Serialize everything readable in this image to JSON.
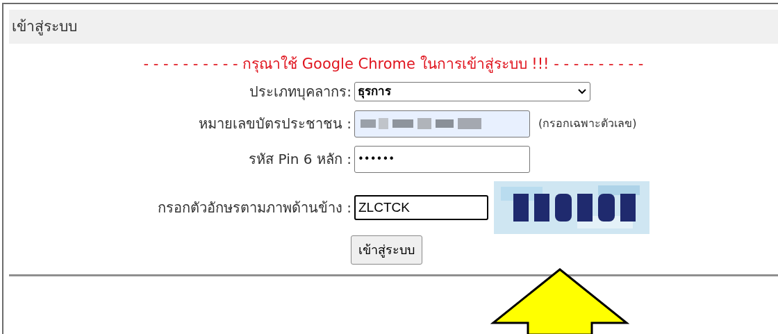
{
  "panel": {
    "title": "เข้าสู่ระบบ"
  },
  "notice": "- - - - - - - - - - กรุณาใช้ Google Chrome ในการเข้าสู่ระบบ !!! - - - -- - - - - -",
  "fields": [
    {
      "kind": "select",
      "label": "ประเภทบุคลากร:",
      "value": "ธุรการ"
    },
    {
      "kind": "redacted",
      "label": "หมายเลขบัตรประชาชน :",
      "hint": "(กรอกเฉพาะตัวเลข)"
    },
    {
      "kind": "password",
      "label": "รหัส Pin 6 หลัก :",
      "value": "••••••"
    },
    {
      "kind": "captcha",
      "label": "กรอกตัวอักษรตามภาพด้านข้าง :",
      "value": "ZLCTCK",
      "focused": true
    }
  ],
  "submit": "เข้าสู่ระบบ"
}
